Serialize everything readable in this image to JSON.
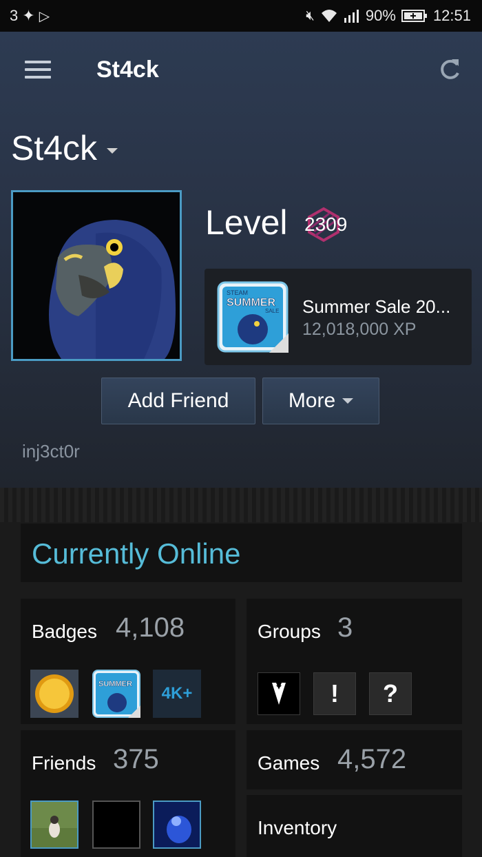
{
  "status_bar": {
    "notification_count": "3",
    "battery": "90%",
    "time": "12:51"
  },
  "app_title": "St4ck",
  "profile": {
    "persona_name": "St4ck",
    "level_label": "Level",
    "level_value": "2309",
    "featured_badge": {
      "title": "Summer Sale 20...",
      "xp": "12,018,000 XP",
      "art_text": "SUMMER",
      "art_top": "STEAM",
      "art_sale": "SALE"
    },
    "username": "inj3ct0r"
  },
  "buttons": {
    "add_friend": "Add Friend",
    "more": "More"
  },
  "status_text": "Currently Online",
  "panels": {
    "badges": {
      "label": "Badges",
      "count": "4,108",
      "thumb_4k": "4K+"
    },
    "groups": {
      "label": "Groups",
      "count": "3",
      "icon2": "!",
      "icon3": "?"
    },
    "friends": {
      "label": "Friends",
      "count": "375"
    },
    "games": {
      "label": "Games",
      "count": "4,572"
    },
    "inventory": {
      "label": "Inventory"
    }
  },
  "colors": {
    "accent": "#56bcd8",
    "avatar_border": "#4b9bc4",
    "header_top": "#2d3b52",
    "panel_bg": "#121212"
  }
}
